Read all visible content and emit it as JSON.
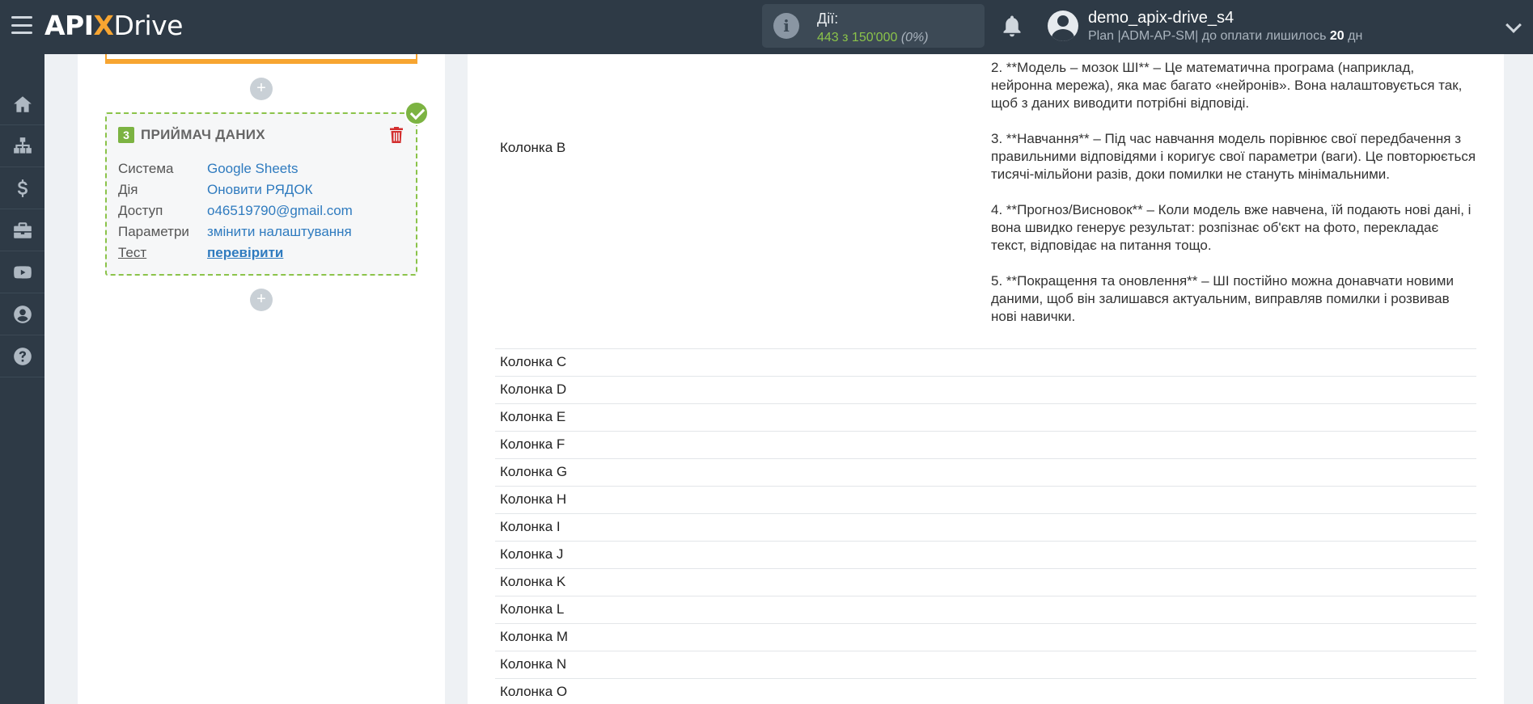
{
  "header": {
    "logo": {
      "prefix": "API",
      "x": "X",
      "suffix": "Drive"
    },
    "actions": {
      "label": "Дії:",
      "count": "443 з 150'000",
      "percent": "(0%)"
    },
    "user": {
      "name": "demo_apix-drive_s4",
      "plan_prefix": "Plan |ADM-AP-SM| до оплати лишилось",
      "days": "20",
      "days_suffix": "дн"
    }
  },
  "sidebar": {
    "items": [
      {
        "icon": "home-icon"
      },
      {
        "icon": "sitemap-icon"
      },
      {
        "icon": "dollar-icon"
      },
      {
        "icon": "briefcase-icon"
      },
      {
        "icon": "youtube-icon"
      },
      {
        "icon": "user-circle-icon"
      },
      {
        "icon": "help-icon"
      }
    ]
  },
  "destination_card": {
    "step": "3",
    "title": "ПРИЙМАЧ ДАНИХ",
    "rows": [
      {
        "key": "Система",
        "value": "Google Sheets"
      },
      {
        "key": "Дія",
        "value": "Оновити РЯДОК"
      },
      {
        "key": "Доступ",
        "value": "o46519790@gmail.com"
      },
      {
        "key": "Параметри",
        "value": "змінити налаштування"
      },
      {
        "key": "Тест",
        "value": "перевірити"
      }
    ]
  },
  "columns": {
    "b": {
      "label": "Колонка B",
      "paragraphs": [
        "2. **Модель – мозок ШІ** – Це математична програма (наприклад, нейронна мережа), яка має багато «нейронів». Вона налаштовується так, щоб з даних виводити потрібні відповіді.",
        "3. **Навчання** – Під час навчання модель порівнює свої передбачення з правильними відповідями і коригує свої параметри (ваги). Це повторюється тисячі-мільйони разів, доки помилки не стануть мінімальними.",
        "4. **Прогноз/Висновок** – Коли модель вже навчена, їй подають нові дані, і вона швидко генерує результат: розпізнає об'єкт на фото, перекладає текст, відповідає на питання тощо.",
        "5. **Покращення та оновлення** – ШІ постійно можна донавчати новими даними, щоб він залишався актуальним, виправляв помилки і розвивав нові навички."
      ]
    },
    "rest": [
      "Колонка C",
      "Колонка D",
      "Колонка E",
      "Колонка F",
      "Колонка G",
      "Колонка H",
      "Колонка I",
      "Колонка J",
      "Колонка K",
      "Колонка L",
      "Колонка M",
      "Колонка N",
      "Колонка O"
    ]
  },
  "colors": {
    "header_bg": "#2e3a46",
    "accent_orange": "#f7a531",
    "success_green": "#7cb342",
    "link_blue": "#2f7bbf",
    "danger_red": "#d32f2f"
  }
}
